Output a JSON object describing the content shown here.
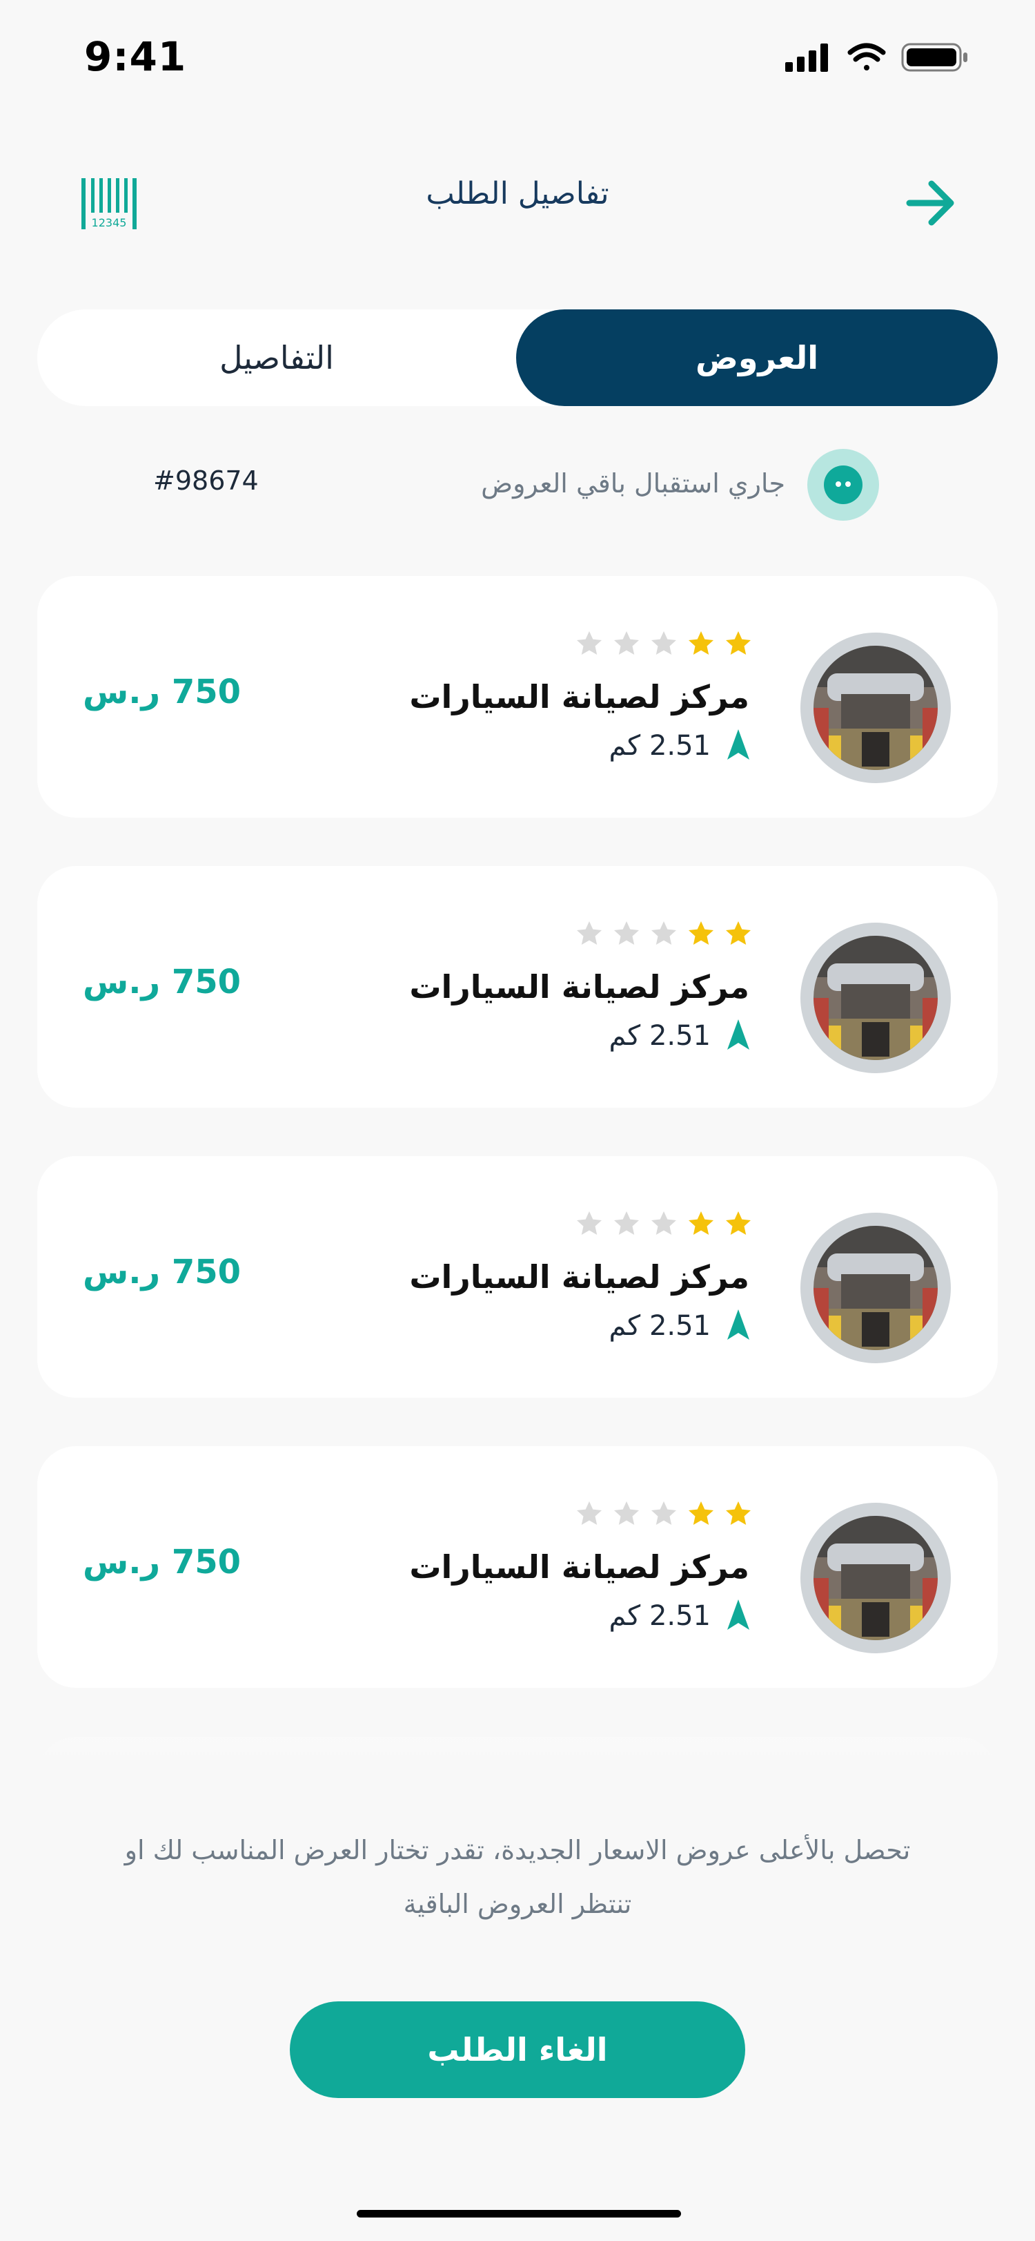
{
  "status_bar": {
    "time": "9:41"
  },
  "header": {
    "title": "تفاصيل الطلب"
  },
  "tabs": {
    "active": "العروض",
    "inactive": "التفاصيل"
  },
  "order": {
    "number": "#98674",
    "waiting_text": "جاري استقبال باقي العروض"
  },
  "offers": [
    {
      "name": "مركز لصيانة السيارات",
      "distance": "2.51 كم",
      "price": "750 ر.س",
      "rating": 2,
      "max_rating": 5
    },
    {
      "name": "مركز لصيانة السيارات",
      "distance": "2.51 كم",
      "price": "750 ر.س",
      "rating": 2,
      "max_rating": 5
    },
    {
      "name": "مركز لصيانة السيارات",
      "distance": "2.51 كم",
      "price": "750 ر.س",
      "rating": 2,
      "max_rating": 5
    },
    {
      "name": "مركز لصيانة السيارات",
      "distance": "2.51 كم",
      "price": "750 ر.س",
      "rating": 2,
      "max_rating": 5
    }
  ],
  "hint": "تحصل بالأعلى عروض الاسعار الجديدة، تقدر تختار العرض المناسب لك او تنتظر العروض الباقية",
  "cancel_button": "الغاء الطلب",
  "colors": {
    "primary_dark": "#053F61",
    "accent": "#10A998",
    "star_on": "#F5C20B",
    "star_off": "#D9D9D9"
  },
  "icons": {
    "back": "arrow-right-icon",
    "barcode": "barcode-icon",
    "location": "navigation-arrow-icon"
  }
}
